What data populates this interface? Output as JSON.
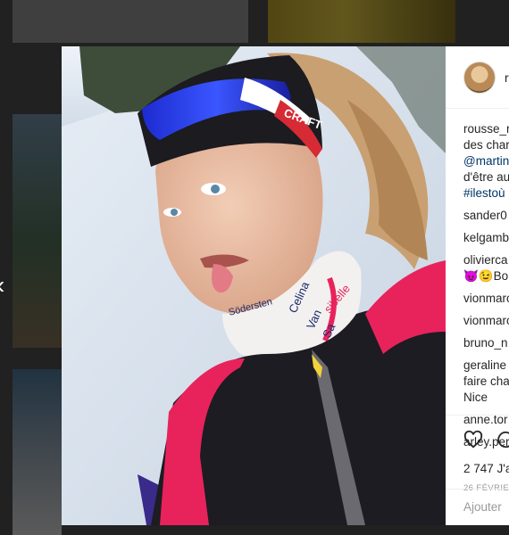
{
  "post": {
    "username_partial": "r",
    "comments": [
      {
        "text": "rousse_r",
        "kind": "user"
      },
      {
        "text": "des char",
        "kind": "text"
      },
      {
        "text": "@martin",
        "kind": "tag"
      },
      {
        "text": "d'être au",
        "kind": "text"
      },
      {
        "text": "#ilestoù",
        "kind": "tag"
      },
      {
        "text": "sander0",
        "kind": "user",
        "gap": true
      },
      {
        "text": "kelgamb",
        "kind": "user",
        "gap": true
      },
      {
        "text": "olivierca",
        "kind": "user",
        "gap": true
      },
      {
        "text": "😈😉Bon",
        "kind": "text"
      },
      {
        "text": "vionmarc",
        "kind": "user",
        "gap": true
      },
      {
        "text": "vionmarc",
        "kind": "user",
        "gap": true
      },
      {
        "text": "bruno_n",
        "kind": "user",
        "gap": true
      },
      {
        "text": "geraline",
        "kind": "user",
        "gap": true
      },
      {
        "text": "faire cha",
        "kind": "text"
      },
      {
        "text": "Nice",
        "kind": "text"
      },
      {
        "text": "anne.tor",
        "kind": "user",
        "gap": true
      },
      {
        "text": "arley.per",
        "kind": "user",
        "gap": true
      }
    ],
    "likes": "2 747 J'a",
    "date": "26 FÉVRIER",
    "add_comment_placeholder": "Ajouter",
    "icons": [
      "heart-icon",
      "comment-icon"
    ]
  },
  "photo": {
    "headband_text": "CRAFT",
    "neck_gaiter_text": [
      "Celina",
      "Van",
      "Sa",
      "sibelle",
      "Södersten"
    ]
  },
  "colors": {
    "jacket_pink": "#e8235c",
    "jacket_black": "#1c1c22",
    "link": "#003569"
  }
}
